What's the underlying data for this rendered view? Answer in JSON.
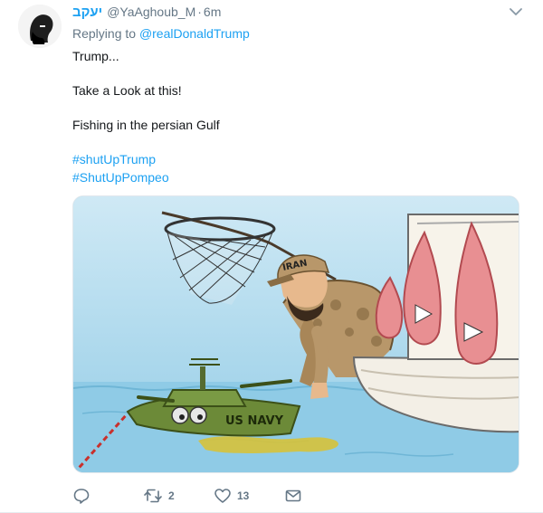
{
  "tweet": {
    "display_name": "יעקב",
    "handle": "@YaAghoub_M",
    "separator": "·",
    "time": "6m",
    "replying_prefix": "Replying to",
    "replying_to": "@realDonaldTrump",
    "lines": [
      "Trump...",
      "Take a Look at this!",
      "Fishing in the persian Gulf"
    ],
    "hashtags": [
      "#shutUpTrump",
      "#ShutUpPompeo"
    ]
  },
  "media": {
    "boat_label": "US NAVY",
    "cap_label": "IRAN"
  },
  "actions": {
    "reply_count": "",
    "retweet_count": "2",
    "like_count": "13"
  },
  "icons": {
    "caret": "chevron-down-icon",
    "reply": "reply-icon",
    "retweet": "retweet-icon",
    "like": "heart-icon",
    "dm": "envelope-icon"
  },
  "colors": {
    "link": "#1da1f2",
    "secondary_text": "#657786",
    "primary_text": "#14171a",
    "water": "#8fcbe6",
    "boat_green": "#6c8a38"
  }
}
